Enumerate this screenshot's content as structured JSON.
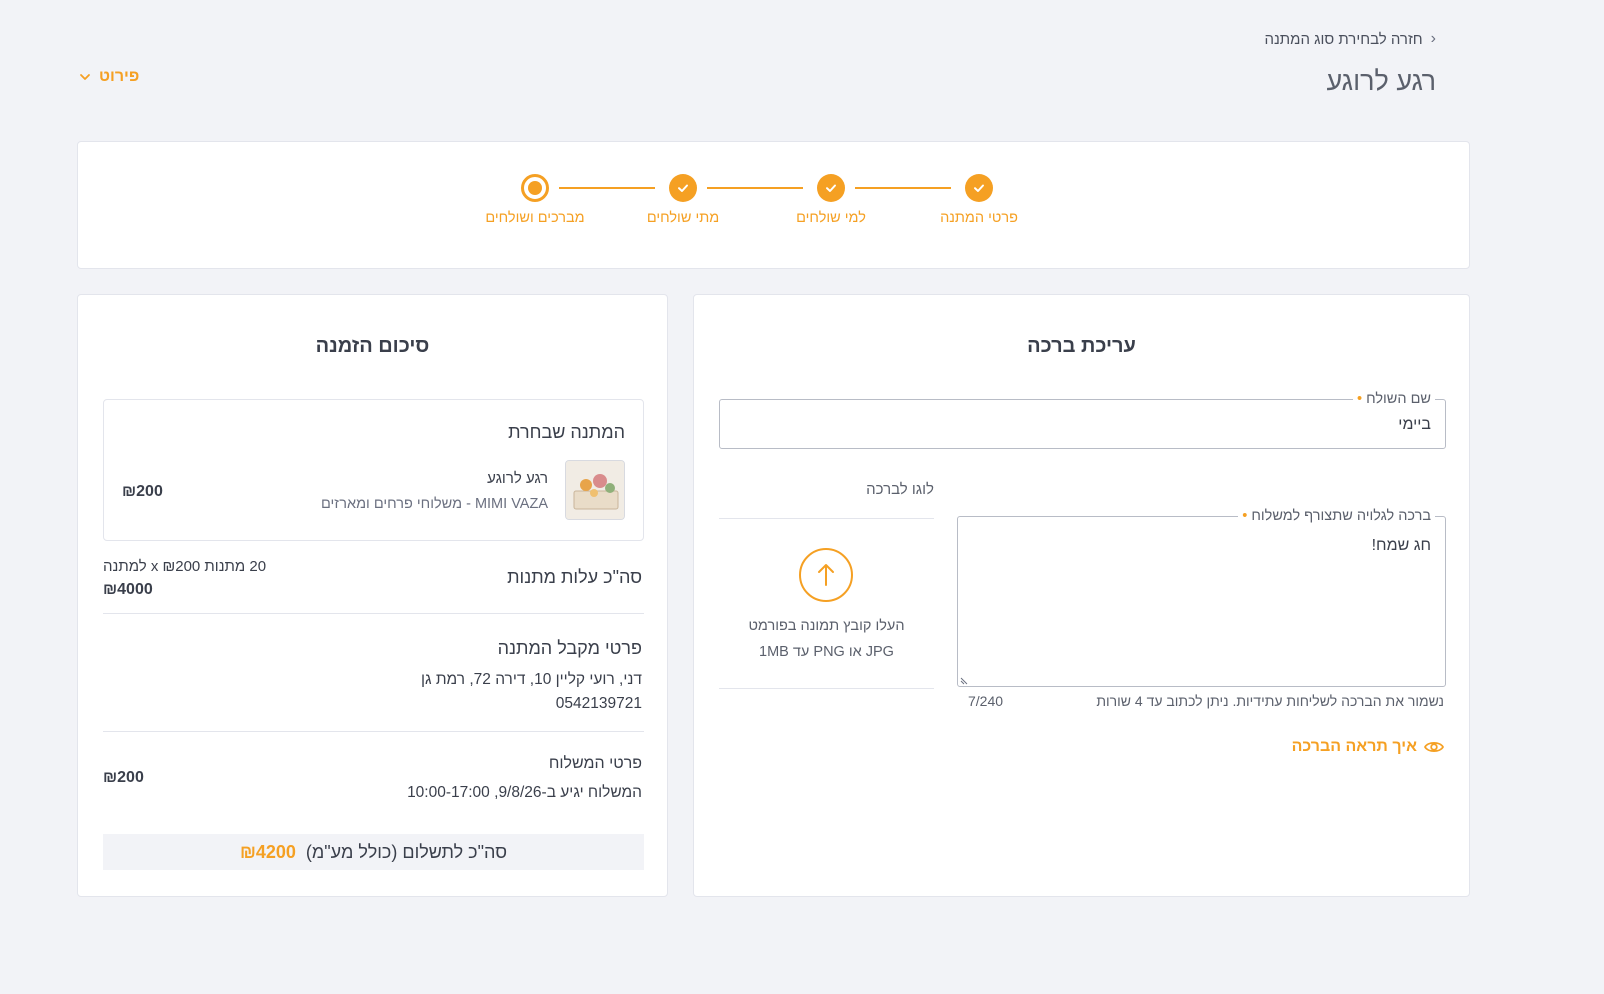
{
  "header": {
    "back_label": "חזרה לבחירת סוג המתנה",
    "title": "רגע לרוגע",
    "details_toggle": "פירוט"
  },
  "stepper": {
    "steps": [
      {
        "label": "פרטי המתנה",
        "state": "done"
      },
      {
        "label": "למי שולחים",
        "state": "done"
      },
      {
        "label": "מתי שולחים",
        "state": "done"
      },
      {
        "label": "מברכים ושולחים",
        "state": "current"
      }
    ]
  },
  "edit": {
    "title": "עריכת ברכה",
    "sender_label": "שם השולח",
    "sender_value": "ביימי",
    "logo_label": "לוגו לברכה",
    "upload_line1": "העלו קובץ תמונה בפורמט",
    "upload_line2": "JPG או PNG עד 1MB",
    "greeting_label": "ברכה לגלויה שתצורף למשלוח",
    "greeting_value": "חג שמח!",
    "hint": "נשמור את הברכה לשליחות עתידיות. ניתן לכתוב עד 4 שורות",
    "counter": "7/240",
    "preview_link": "איך תראה הברכה"
  },
  "summary": {
    "title": "סיכום הזמנה",
    "gift_box_title": "המתנה שבחרת",
    "gift_name": "רגע לרוגע",
    "gift_sub": "MIMI VAZA - משלוחי פרחים ומארזים",
    "gift_price": "₪200",
    "gifts_cost_label": "סה\"כ עלות מתנות",
    "gifts_cost_detail": "20 מתנות x ₪200 למתנה",
    "gifts_cost_total": "₪4000",
    "recipient_title": "פרטי מקבל המתנה",
    "recipient_address": "דני, רועי קליין 10, דירה 72, רמת גן",
    "recipient_phone": "0542139721",
    "shipping_title": "פרטי המשלוח",
    "shipping_text": "המשלוח יגיע ב-9/8/26, 10:00-17:00",
    "shipping_price": "₪200",
    "total_label": "סה\"כ לתשלום (כולל מע\"מ)",
    "total_value": "₪4200"
  },
  "colors": {
    "accent": "#f5a023",
    "background": "#f2f3f7",
    "text": "#3a3f4b"
  },
  "icons": {
    "back": "chevron-right-icon",
    "details": "chevron-down-icon",
    "step_done": "check-icon",
    "upload": "upload-arrow-icon",
    "preview": "eye-icon"
  }
}
